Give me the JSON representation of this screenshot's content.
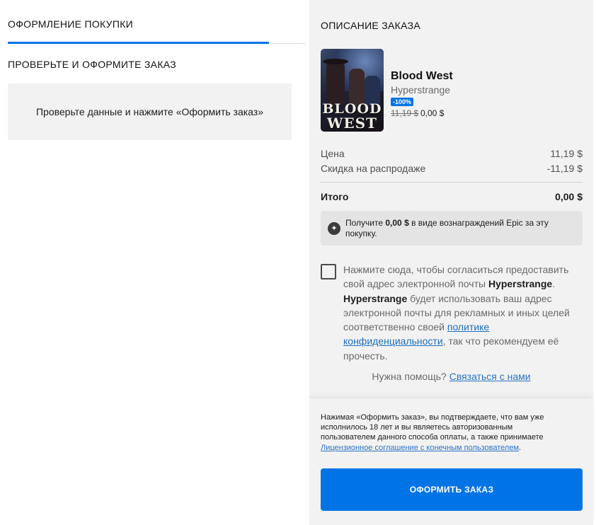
{
  "left": {
    "tab_label": "ОФОРМЛЕНИЕ ПОКУПКИ",
    "subtitle": "ПРОВЕРЬТЕ И ОФОРМИТЕ ЗАКАЗ",
    "info_text": "Проверьте данные и нажмите «Оформить заказ»"
  },
  "summary": {
    "title": "ОПИСАНИЕ ЗАКАЗА",
    "product": {
      "cover_text_line1": "BLOOD",
      "cover_text_line2": "WEST",
      "name": "Blood West",
      "developer": "Hyperstrange",
      "discount_badge": "-100%",
      "original_price": "11,19 $",
      "final_price": "0,00 $"
    },
    "price_label": "Цена",
    "price_value": "11,19 $",
    "sale_label": "Скидка на распродаже",
    "sale_value": "-11,19 $",
    "total_label": "Итого",
    "total_value": "0,00 $",
    "reward": {
      "prefix": "Получите ",
      "amount": "0,00 $",
      "suffix": " в виде вознаграждений Epic за эту покупку."
    },
    "consent": {
      "part1": "Нажмите сюда, чтобы согласиться предоставить свой адрес электронной почты ",
      "publisher1": "Hyperstrange",
      "part2": ". ",
      "publisher2": "Hyperstrange",
      "part3": " будет использовать ваш адрес электронной почты для рекламных и иных целей соответственно своей ",
      "policy_link": "политике конфиденциальности",
      "part4": ", так что рекомендуем её прочесть."
    },
    "help": {
      "question": "Нужна помощь? ",
      "contact_link": "Связаться с нами"
    },
    "terms": {
      "text": "Нажимая «Оформить заказ», вы подтверждаете, что вам уже исполнилось 18 лет и вы являетесь авторизованным пользователем данного способа оплаты, а также принимаете ",
      "eula_link": "Лицензионное соглашение с конечным пользователем",
      "end": "."
    },
    "place_order_label": "ОФОРМИТЬ ЗАКАЗ"
  },
  "colors": {
    "accent": "#0074e4",
    "panel": "#f2f2f2",
    "link": "#2a74c8"
  },
  "icons": {
    "reward": "epic-rewards-icon"
  }
}
